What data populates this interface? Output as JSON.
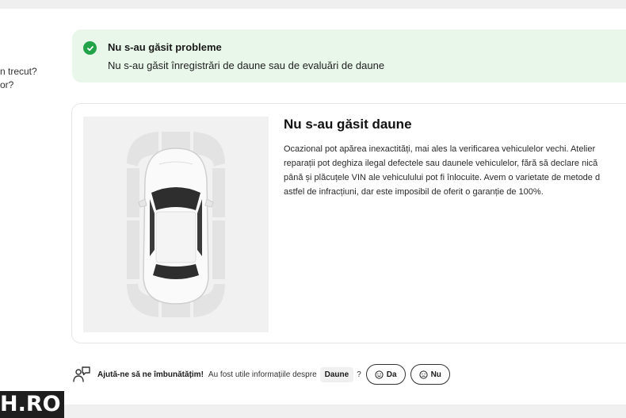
{
  "left_column": {
    "line1": "n trecut?",
    "line2": "or?"
  },
  "alert": {
    "title": "Nu s-au găsit probleme",
    "description": "Nu s-au găsit înregistrări de daune sau de evaluări de daune",
    "accent_color": "#22a34a",
    "background_color": "#e8f7ea"
  },
  "damage_card": {
    "heading": "Nu s-au găsit daune",
    "body_lines": [
      "Ocazional pot apărea inexactități, mai ales la verificarea vehiculelor vechi. Atelier",
      "reparații pot deghiza ilegal defectele sau daunele vehiculelor, fără să declare nică",
      "până și plăcuțele VIN ale vehiculului pot fi înlocuite. Avem o varietate de metode d",
      "astfel de infracțiuni, dar este imposibil de oferit o garanție de 100%."
    ]
  },
  "feedback": {
    "icon": "feedback-person-icon",
    "bold_text": "Ajută-ne să ne îmbunătățim!",
    "question": "Au fost utile informațiile despre",
    "topic_chip": "Daune",
    "question_mark": "?",
    "yes_label": "Da",
    "no_label": "Nu"
  },
  "brand": {
    "text": "H.RO"
  }
}
